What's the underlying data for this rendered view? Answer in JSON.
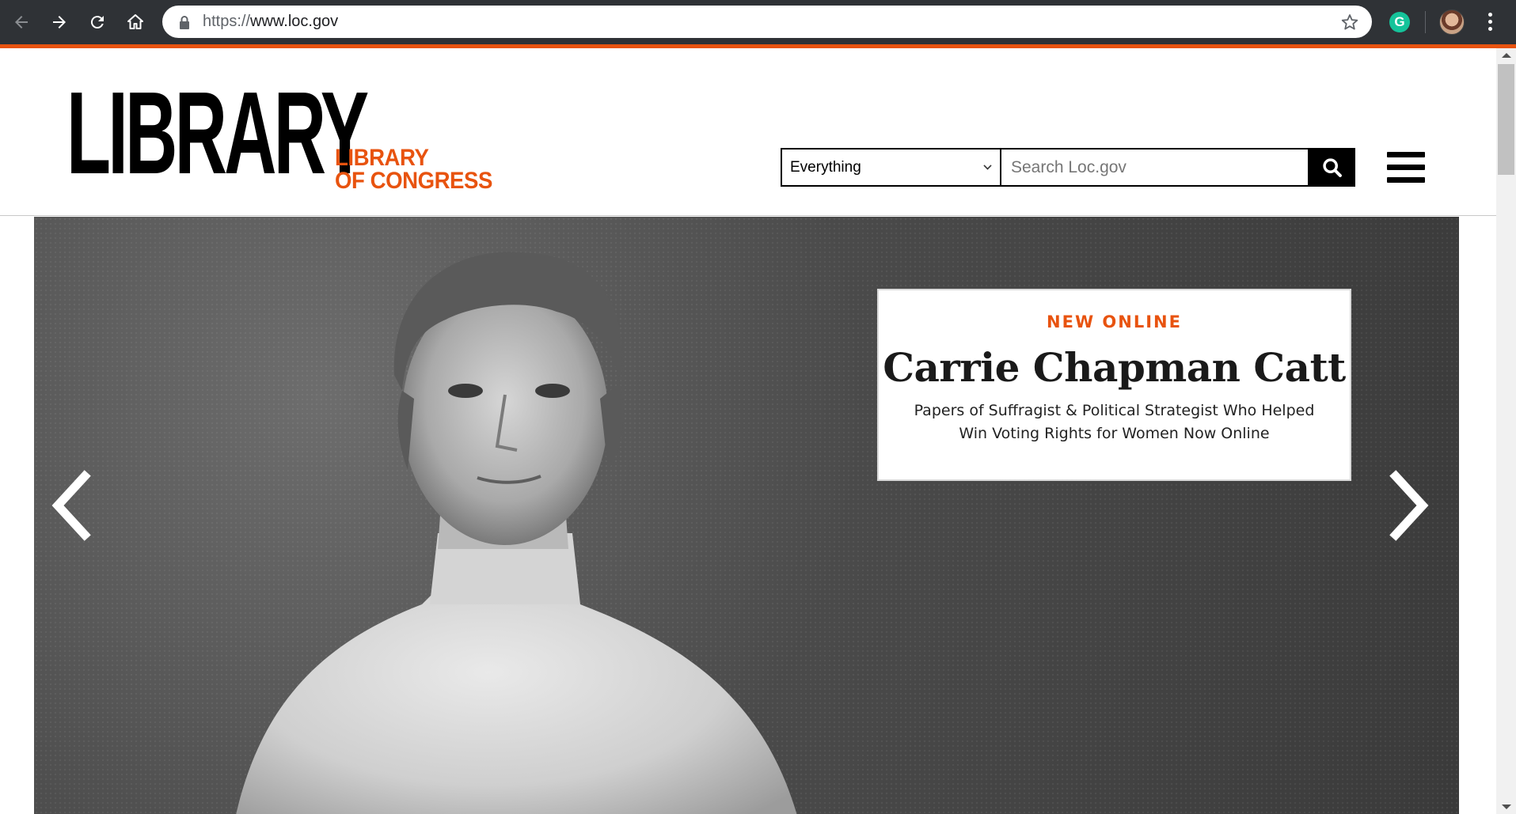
{
  "browser": {
    "url_protocol": "https://",
    "url_host": "www.loc.gov",
    "back_icon": "arrow-left-icon",
    "forward_icon": "arrow-right-icon",
    "reload_icon": "reload-icon",
    "home_icon": "home-icon",
    "extension_label": "G",
    "accent_color": "#e8530f"
  },
  "header": {
    "logo_main": "LIBRARY",
    "logo_sub_line1": "LIBRARY",
    "logo_sub_line2": "OF CONGRESS",
    "search_scope": "Everything",
    "search_placeholder": "Search Loc.gov"
  },
  "hero": {
    "kicker": "NEW ONLINE",
    "title": "Carrie Chapman Catt",
    "description": "Papers of Suffragist & Political Strategist Who Helped Win Voting Rights for Women Now Online"
  }
}
